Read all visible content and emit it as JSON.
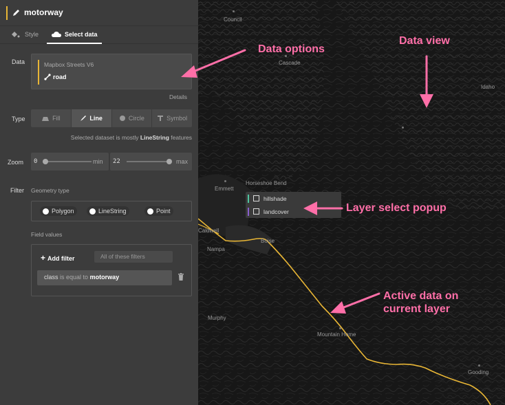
{
  "header": {
    "title": "motorway"
  },
  "tabs": [
    {
      "label": "Style"
    },
    {
      "label": "Select data"
    }
  ],
  "labels": {
    "data": "Data",
    "type": "Type",
    "zoom": "Zoom",
    "filter": "Filter"
  },
  "data_source": {
    "name": "Mapbox Streets V6",
    "layer": "road",
    "details_label": "Details"
  },
  "type_buttons": [
    {
      "label": "Fill",
      "icon": "fill-icon"
    },
    {
      "label": "Line",
      "icon": "line-icon",
      "active": true
    },
    {
      "label": "Circle",
      "icon": "circle-icon"
    },
    {
      "label": "Symbol",
      "icon": "symbol-icon"
    }
  ],
  "type_hint": {
    "prefix": "Selected dataset is mostly ",
    "geometry": "LineString",
    "suffix": " features"
  },
  "zoom": {
    "min_value": "0",
    "min_unit": "min",
    "max_value": "22",
    "max_unit": "max"
  },
  "filter": {
    "geometry_label": "Geometry type",
    "geometry_options": [
      "Polygon",
      "LineString",
      "Point"
    ],
    "field_values_label": "Field values",
    "add_filter_label": "Add filter",
    "match_mode": "All of these filters",
    "condition": {
      "key": "class",
      "operator": "is equal to",
      "value": "motorway"
    }
  },
  "map": {
    "places": [
      "Council",
      "Cascade",
      "Idaho",
      "Emmett",
      "Horseshoe Bend",
      "Caldwell",
      "Nampa",
      "Boise",
      "Murphy",
      "Mountain Home",
      "Gooding"
    ],
    "popup_layers": [
      {
        "name": "hillshade",
        "color": "#4fc6a0"
      },
      {
        "name": "landcover",
        "color": "#8a5fd0"
      }
    ],
    "road_color": "#e9b635"
  },
  "annotations": {
    "data_options": "Data options",
    "data_view": "Data view",
    "layer_select_popup": "Layer select popup",
    "active_data_line1": "Active data on",
    "active_data_line2": "current layer"
  },
  "colors": {
    "accent": "#e9b635",
    "annotation": "#ff6fa8",
    "sidebar_bg": "#3c3c3c",
    "map_bg": "#161616"
  }
}
